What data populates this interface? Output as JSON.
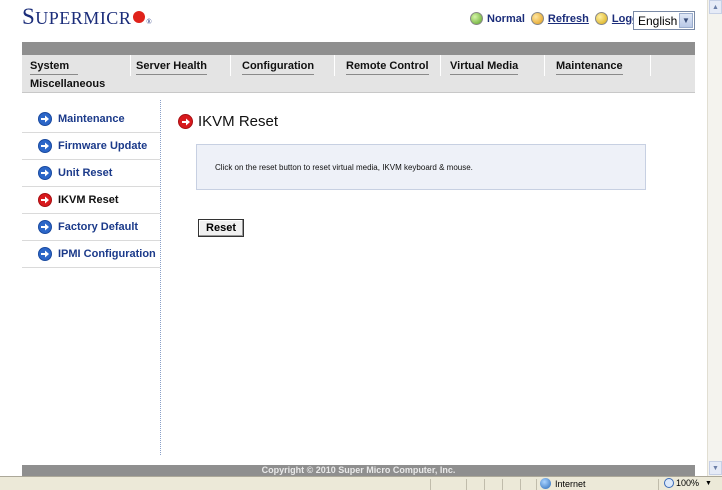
{
  "header": {
    "logo_big": "S",
    "logo_small": "UPERMICR",
    "logo_reg": "®",
    "status": "Normal",
    "refresh": "Refresh",
    "logout": "Logout",
    "language": "English"
  },
  "menu": {
    "row1": [
      "System",
      "Server Health",
      "Configuration",
      "Remote Control",
      "Virtual Media",
      "Maintenance"
    ],
    "row2": [
      "Miscellaneous"
    ]
  },
  "sidebar": {
    "items": [
      {
        "label": "Maintenance",
        "active": false
      },
      {
        "label": "Firmware Update",
        "active": false
      },
      {
        "label": "Unit Reset",
        "active": false
      },
      {
        "label": "IKVM Reset",
        "active": true
      },
      {
        "label": "Factory Default",
        "active": false
      },
      {
        "label": "IPMI Configuration",
        "active": false
      }
    ]
  },
  "main": {
    "title": "IKVM Reset",
    "info": "Click on the reset button to reset virtual media, IKVM keyboard & mouse.",
    "reset_label": "Reset"
  },
  "footer": {
    "copyright": "Copyright © 2010 Super Micro Computer, Inc."
  },
  "browser_status": {
    "zone": "Internet",
    "zoom": "100%"
  },
  "colors": {
    "brand_blue": "#1b2d7a",
    "accent_red": "#d8191d",
    "link_blue": "#1b3a8a",
    "menu_bg": "#e4e4e4",
    "band_gray": "#8f8f8f"
  },
  "icons": {
    "status": "ok-check-icon",
    "refresh": "refresh-icon",
    "logout": "logout-icon",
    "nav": "arrow-right-circle-icon",
    "zone": "globe-icon",
    "zoom": "zoom-icon"
  }
}
